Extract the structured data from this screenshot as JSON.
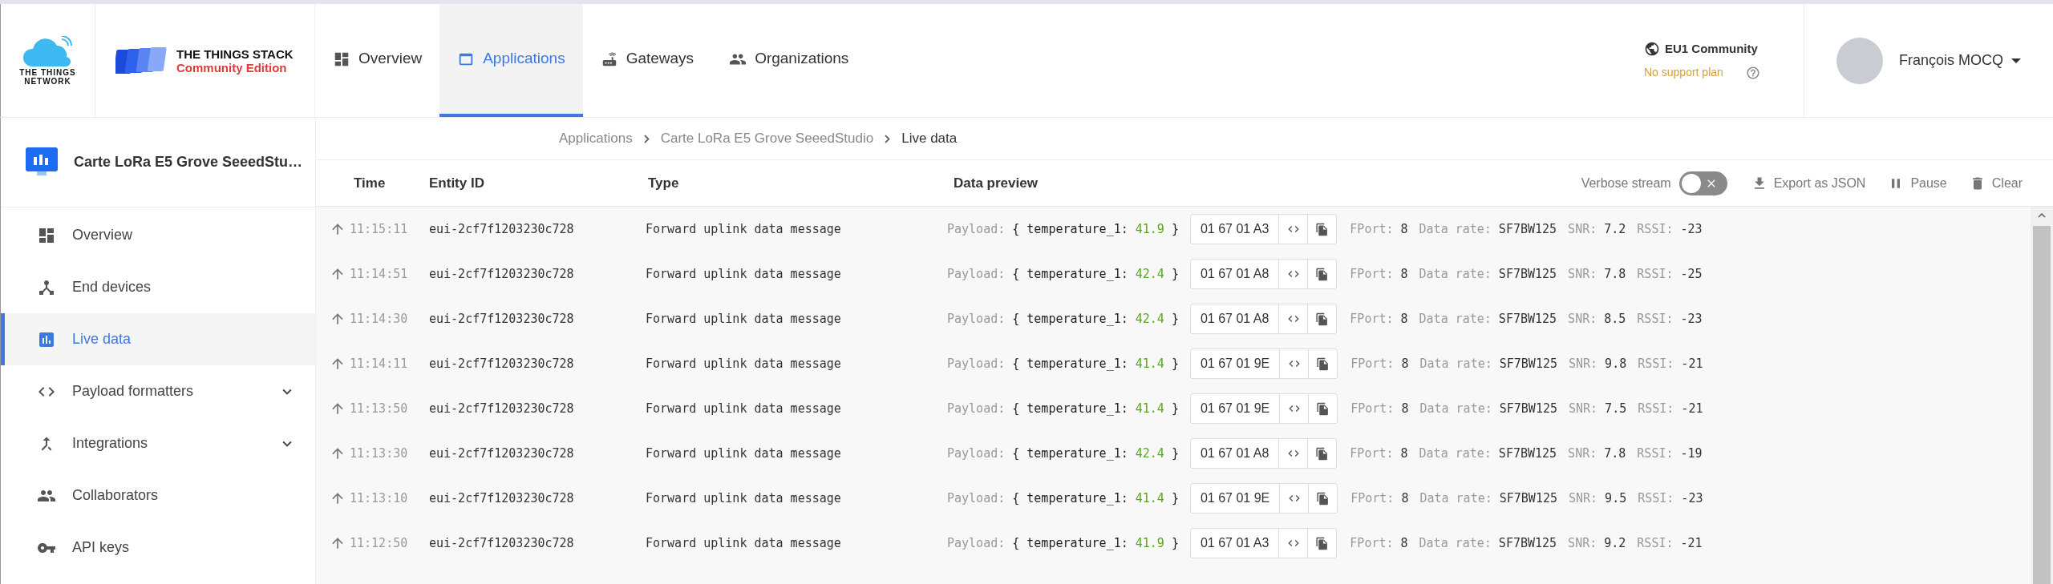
{
  "header": {
    "ttn_logo": [
      "THE THINGS",
      "NETWORK"
    ],
    "stack_logo": {
      "title": "THE THINGS STACK",
      "edition": "Community Edition"
    },
    "nav": [
      {
        "label": "Overview",
        "selected": false
      },
      {
        "label": "Applications",
        "selected": true
      },
      {
        "label": "Gateways",
        "selected": false
      },
      {
        "label": "Organizations",
        "selected": false
      }
    ],
    "cluster": {
      "name": "EU1 Community",
      "plan": "No support plan"
    },
    "user": {
      "name": "François MOCQ"
    }
  },
  "sidebar": {
    "app_title": "Carte LoRa E5 Grove SeeedStu…",
    "items": [
      {
        "label": "Overview",
        "selected": false,
        "expandable": false
      },
      {
        "label": "End devices",
        "selected": false,
        "expandable": false
      },
      {
        "label": "Live data",
        "selected": true,
        "expandable": false
      },
      {
        "label": "Payload formatters",
        "selected": false,
        "expandable": true
      },
      {
        "label": "Integrations",
        "selected": false,
        "expandable": true
      },
      {
        "label": "Collaborators",
        "selected": false,
        "expandable": false
      },
      {
        "label": "API keys",
        "selected": false,
        "expandable": false
      }
    ]
  },
  "breadcrumb": [
    "Applications",
    "Carte LoRa E5 Grove SeeedStudio",
    "Live data"
  ],
  "table": {
    "columns": [
      "Time",
      "Entity ID",
      "Type",
      "Data preview"
    ],
    "verbose_stream": {
      "label": "Verbose stream",
      "on": false
    },
    "actions": [
      "Export as JSON",
      "Pause",
      "Clear"
    ],
    "rows": [
      {
        "time": "11:15:11",
        "entity_id": "eui-2cf7f1203230c728",
        "type": "Forward uplink data message",
        "payload_label": "Payload:",
        "key": "{ temperature_1:",
        "value": "41.9",
        "close": "}",
        "hex": "01 67 01 A3",
        "fport_label": "FPort:",
        "fport": "8",
        "rate_label": "Data rate:",
        "rate": "SF7BW125",
        "snr_label": "SNR:",
        "snr": "7.2",
        "rssi_label": "RSSI:",
        "rssi": "-23"
      },
      {
        "time": "11:14:51",
        "entity_id": "eui-2cf7f1203230c728",
        "type": "Forward uplink data message",
        "payload_label": "Payload:",
        "key": "{ temperature_1:",
        "value": "42.4",
        "close": "}",
        "hex": "01 67 01 A8",
        "fport_label": "FPort:",
        "fport": "8",
        "rate_label": "Data rate:",
        "rate": "SF7BW125",
        "snr_label": "SNR:",
        "snr": "7.8",
        "rssi_label": "RSSI:",
        "rssi": "-25"
      },
      {
        "time": "11:14:30",
        "entity_id": "eui-2cf7f1203230c728",
        "type": "Forward uplink data message",
        "payload_label": "Payload:",
        "key": "{ temperature_1:",
        "value": "42.4",
        "close": "}",
        "hex": "01 67 01 A8",
        "fport_label": "FPort:",
        "fport": "8",
        "rate_label": "Data rate:",
        "rate": "SF7BW125",
        "snr_label": "SNR:",
        "snr": "8.5",
        "rssi_label": "RSSI:",
        "rssi": "-23"
      },
      {
        "time": "11:14:11",
        "entity_id": "eui-2cf7f1203230c728",
        "type": "Forward uplink data message",
        "payload_label": "Payload:",
        "key": "{ temperature_1:",
        "value": "41.4",
        "close": "}",
        "hex": "01 67 01 9E",
        "fport_label": "FPort:",
        "fport": "8",
        "rate_label": "Data rate:",
        "rate": "SF7BW125",
        "snr_label": "SNR:",
        "snr": "9.8",
        "rssi_label": "RSSI:",
        "rssi": "-21"
      },
      {
        "time": "11:13:50",
        "entity_id": "eui-2cf7f1203230c728",
        "type": "Forward uplink data message",
        "payload_label": "Payload:",
        "key": "{ temperature_1:",
        "value": "41.4",
        "close": "}",
        "hex": "01 67 01 9E",
        "fport_label": "FPort:",
        "fport": "8",
        "rate_label": "Data rate:",
        "rate": "SF7BW125",
        "snr_label": "SNR:",
        "snr": "7.5",
        "rssi_label": "RSSI:",
        "rssi": "-21"
      },
      {
        "time": "11:13:30",
        "entity_id": "eui-2cf7f1203230c728",
        "type": "Forward uplink data message",
        "payload_label": "Payload:",
        "key": "{ temperature_1:",
        "value": "42.4",
        "close": "}",
        "hex": "01 67 01 A8",
        "fport_label": "FPort:",
        "fport": "8",
        "rate_label": "Data rate:",
        "rate": "SF7BW125",
        "snr_label": "SNR:",
        "snr": "7.8",
        "rssi_label": "RSSI:",
        "rssi": "-19"
      },
      {
        "time": "11:13:10",
        "entity_id": "eui-2cf7f1203230c728",
        "type": "Forward uplink data message",
        "payload_label": "Payload:",
        "key": "{ temperature_1:",
        "value": "41.4",
        "close": "}",
        "hex": "01 67 01 9E",
        "fport_label": "FPort:",
        "fport": "8",
        "rate_label": "Data rate:",
        "rate": "SF7BW125",
        "snr_label": "SNR:",
        "snr": "9.5",
        "rssi_label": "RSSI:",
        "rssi": "-23"
      },
      {
        "time": "11:12:50",
        "entity_id": "eui-2cf7f1203230c728",
        "type": "Forward uplink data message",
        "payload_label": "Payload:",
        "key": "{ temperature_1:",
        "value": "41.9",
        "close": "}",
        "hex": "01 67 01 A3",
        "fport_label": "FPort:",
        "fport": "8",
        "rate_label": "Data rate:",
        "rate": "SF7BW125",
        "snr_label": "SNR:",
        "snr": "9.2",
        "rssi_label": "RSSI:",
        "rssi": "-21"
      }
    ]
  }
}
